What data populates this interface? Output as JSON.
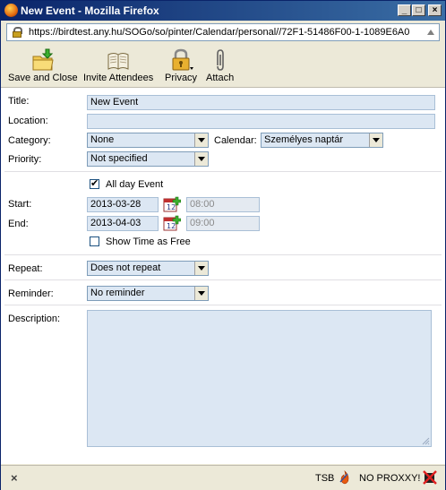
{
  "window": {
    "title": "New Event - Mozilla Firefox",
    "url": "https://birdtest.any.hu/SOGo/so/pinter/Calendar/personal//72F1-51486F00-1-1089E6A0"
  },
  "toolbar": {
    "save_label": "Save and Close",
    "invite_label": "Invite Attendees",
    "privacy_label": "Privacy",
    "attach_label": "Attach"
  },
  "form": {
    "title_label": "Title:",
    "title_value": "New Event",
    "location_label": "Location:",
    "location_value": "",
    "category_label": "Category:",
    "category_value": "None",
    "calendar_label": "Calendar:",
    "calendar_value": "Személyes naptár",
    "priority_label": "Priority:",
    "priority_value": "Not specified",
    "allday_label": "All day Event",
    "allday_checked": true,
    "start_label": "Start:",
    "start_date": "2013-03-28",
    "start_time": "08:00",
    "end_label": "End:",
    "end_date": "2013-04-03",
    "end_time": "09:00",
    "showfree_label": "Show Time as Free",
    "showfree_checked": false,
    "repeat_label": "Repeat:",
    "repeat_value": "Does not repeat",
    "reminder_label": "Reminder:",
    "reminder_value": "No reminder",
    "description_label": "Description:",
    "description_value": ""
  },
  "statusbar": {
    "close_glyph": "×",
    "tsb_label": "TSB",
    "proxy_label": "NO PROXXY!"
  },
  "colors": {
    "titlebar_start": "#0a246a",
    "titlebar_end": "#3a6ea5",
    "field_bg": "#dce7f3",
    "chrome_bg": "#ece9d8"
  }
}
